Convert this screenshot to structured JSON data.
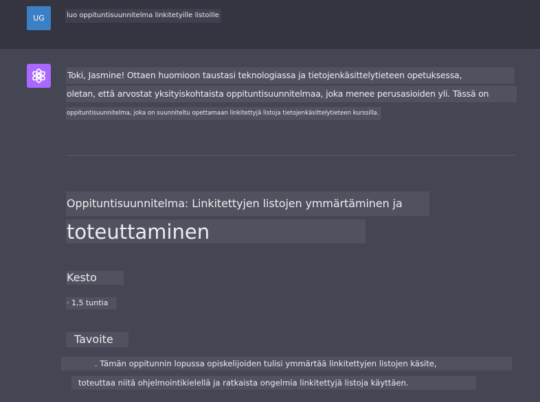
{
  "user": {
    "avatar_initials": "UG",
    "message": "luo oppituntisuunnitelma linkitetyille listoille"
  },
  "assistant": {
    "avatar_icon": "openai-logo-icon",
    "intro_lines": [
      "Toki, Jasmine! Ottaen huomioon taustasi teknologiassa ja tietojenkäsittelytieteen opetuksessa,",
      "oletan, että arvostat yksityiskohtaista oppituntisuunnitelmaa, joka menee perusasioiden yli. Tässä on",
      "oppituntisuunnitelma, joka on suunniteltu opettamaan linkitettyjä listoja tietojenkäsittelytieteen kurssilla."
    ],
    "lesson": {
      "title_line1": "Oppituntisuunnitelma: Linkitettyjen listojen ymmärtäminen ja",
      "title_line2": "toteuttaminen",
      "duration_heading": "Kesto",
      "duration_item": "· 1,5 tuntia",
      "goal_heading": "Tavoite",
      "goal_lines": [
        ". Tämän oppitunnin lopussa opiskelijoiden tulisi ymmärtää linkitettyjen listojen käsite,",
        "toteuttaa niitä ohjelmointikielellä ja ratkaista ongelmia linkitettyjä listoja käyttäen."
      ]
    }
  },
  "colors": {
    "page_bg": "#444654",
    "user_row_bg": "#343541",
    "user_avatar": "#3b80c4",
    "assistant_avatar": "#ab68ff",
    "text_highlight": "#51525f"
  }
}
